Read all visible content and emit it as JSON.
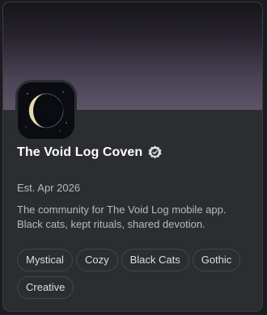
{
  "server": {
    "name": "The Void Log Coven",
    "established": "Est. Apr 2026",
    "description": "The community for The Void Log mobile app. Black cats, kept rituals, shared devotion.",
    "verified_icon": "verified-badge-icon",
    "server_icon": "crescent-moon-icon"
  },
  "tags": [
    {
      "label": "Mystical"
    },
    {
      "label": "Cozy"
    },
    {
      "label": "Black Cats"
    },
    {
      "label": "Gothic"
    },
    {
      "label": "Creative"
    }
  ],
  "colors": {
    "card_bg": "#2b2d31",
    "text_primary": "#ffffff",
    "text_secondary": "#b5bac1",
    "tag_border": "#45474d"
  }
}
